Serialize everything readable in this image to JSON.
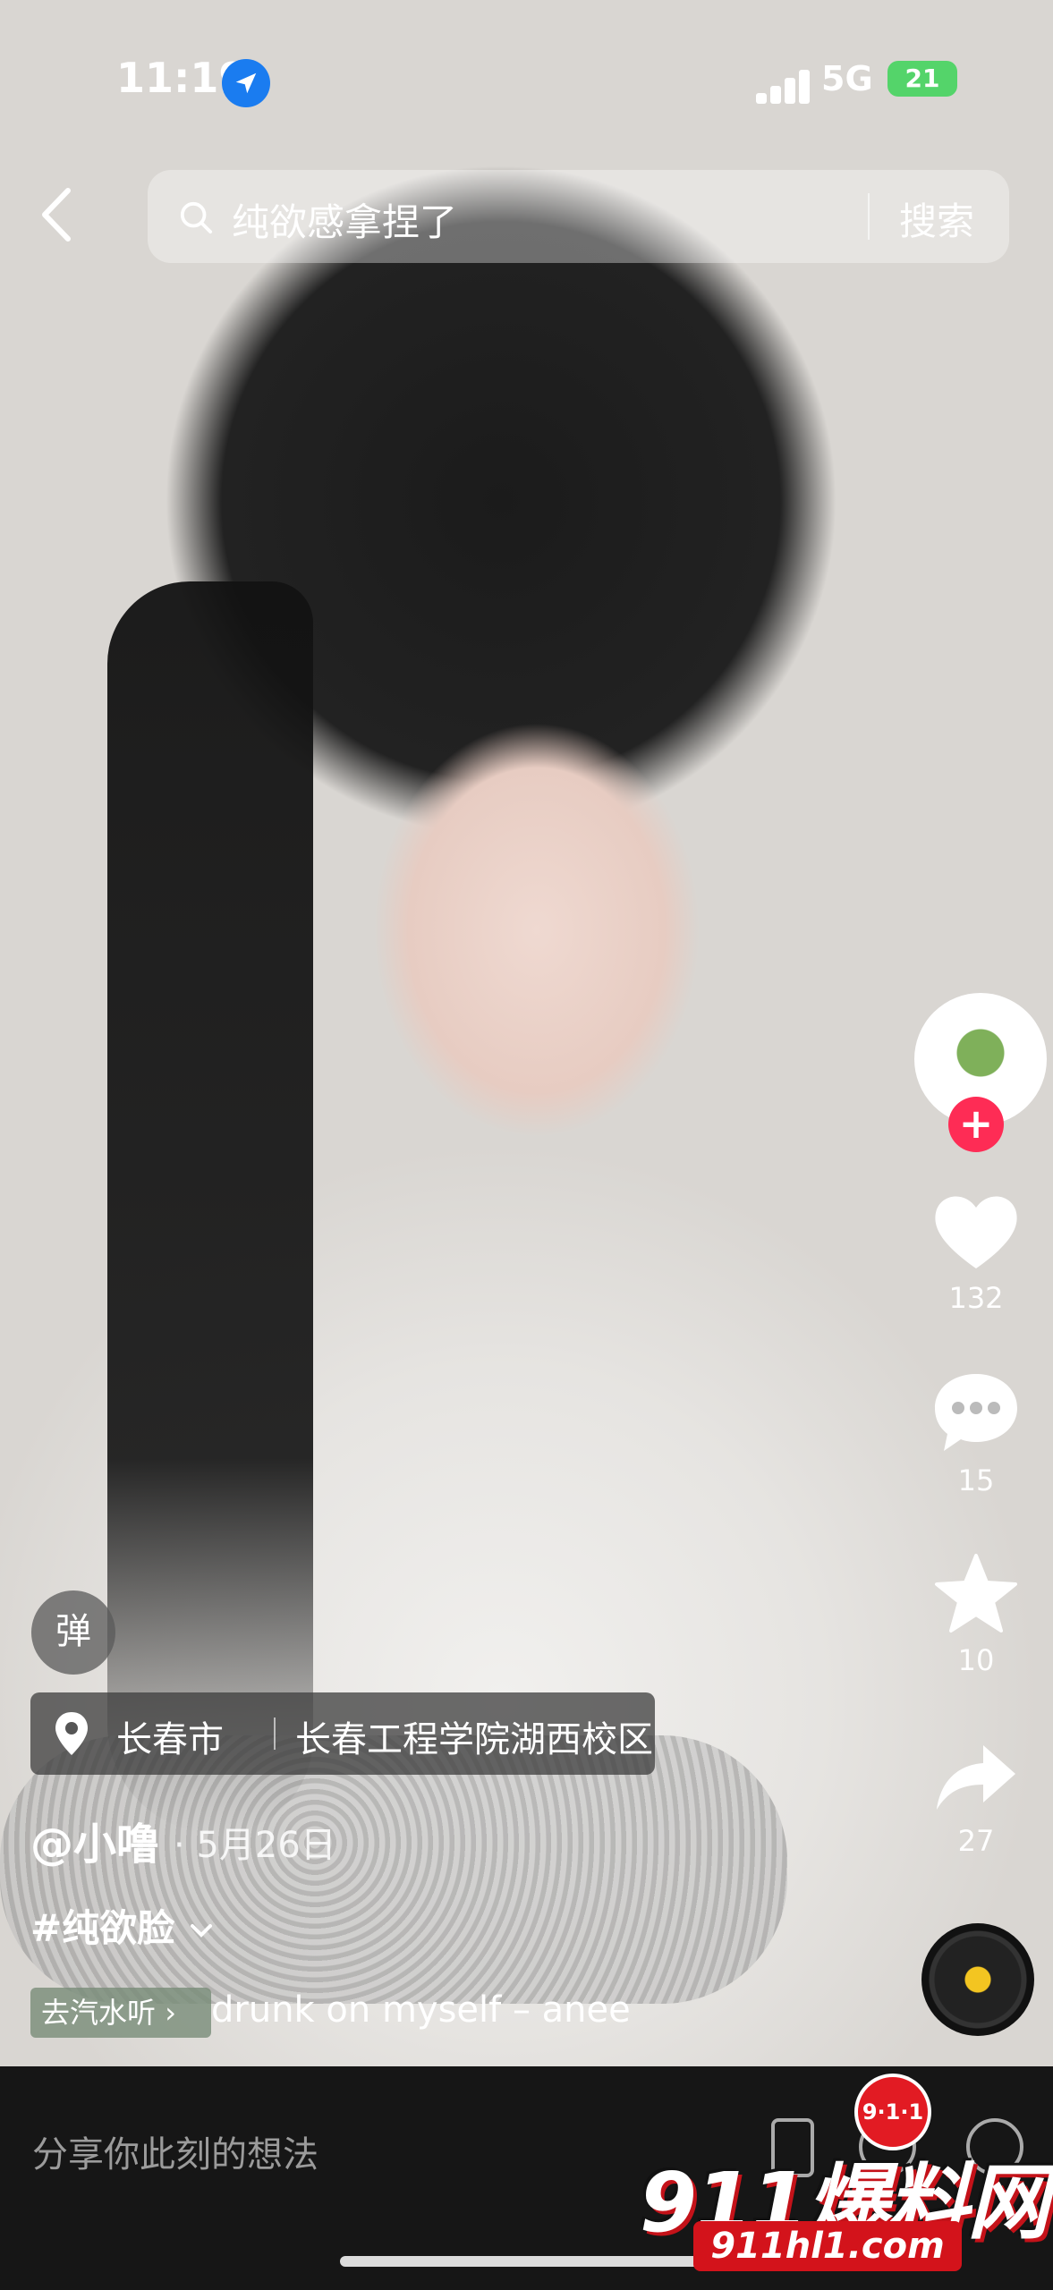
{
  "status_bar": {
    "time": "11:19",
    "network": "5G",
    "battery": "21"
  },
  "header": {
    "search_text": "纯欲感拿捏了",
    "search_button": "搜索"
  },
  "rail": {
    "like_count": "132",
    "comment_count": "15",
    "favorite_count": "10",
    "share_count": "27"
  },
  "post": {
    "danmu_label": "弹",
    "location_city": "长春市",
    "location_place": "长春工程学院湖西校区",
    "author": "@小噜",
    "date": "· 5月26日",
    "hashtag": "#纯欲脸",
    "music_go": "去汽水听",
    "music_title": "drunk on myself – anee"
  },
  "comment_bar": {
    "placeholder": "分享你此刻的想法"
  },
  "watermark": {
    "badge": "9·1·1",
    "brand": "911爆料网",
    "url": "911hl1.com"
  },
  "colors": {
    "follow_red": "#fe2c55",
    "location_blue": "#1a7cf0",
    "battery_green": "#54d46a"
  }
}
